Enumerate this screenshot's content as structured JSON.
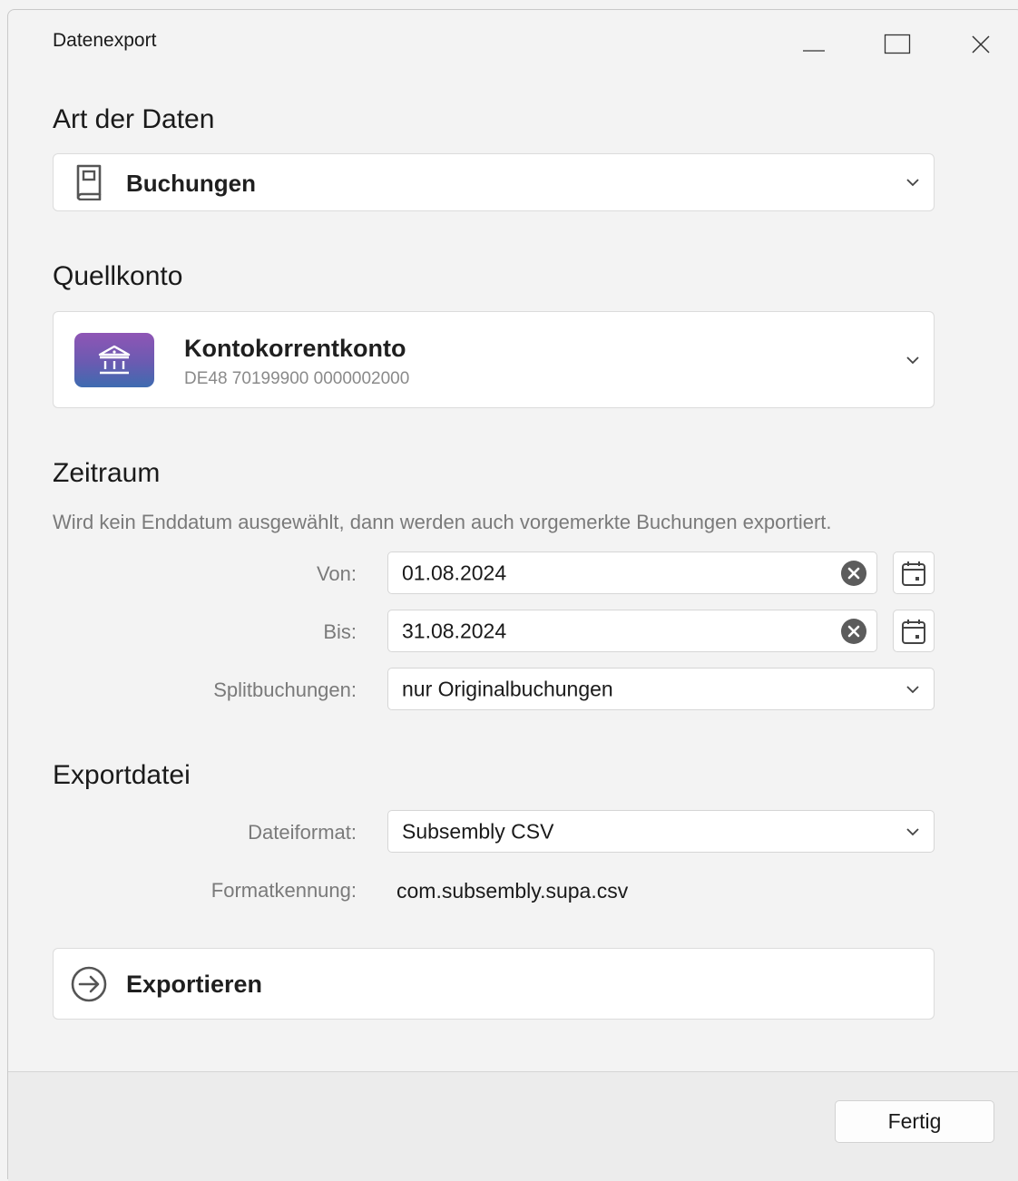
{
  "window": {
    "title": "Datenexport",
    "controls": {
      "minimize": "minimize-icon",
      "maximize": "maximize-icon",
      "close": "close-icon"
    }
  },
  "data_type": {
    "heading": "Art der Daten",
    "selected": "Buchungen",
    "icon": "book-icon"
  },
  "source_account": {
    "heading": "Quellkonto",
    "name": "Kontokorrentkonto",
    "iban": "DE48 70199900 0000002000",
    "icon": "bank-icon",
    "tile_color": "#7a55b3"
  },
  "period": {
    "heading": "Zeitraum",
    "hint": "Wird kein Enddatum ausgewählt, dann werden auch vorgemerkte Buchungen exportiert.",
    "from_label": "Von:",
    "from_value": "01.08.2024",
    "to_label": "Bis:",
    "to_value": "31.08.2024",
    "split_label": "Splitbuchungen:",
    "split_value": "nur Originalbuchungen"
  },
  "export_file": {
    "heading": "Exportdatei",
    "format_label": "Dateiformat:",
    "format_value": "Subsembly CSV",
    "id_label": "Formatkennung:",
    "id_value": "com.subsembly.supa.csv"
  },
  "actions": {
    "export_label": "Exportieren",
    "done_label": "Fertig"
  }
}
